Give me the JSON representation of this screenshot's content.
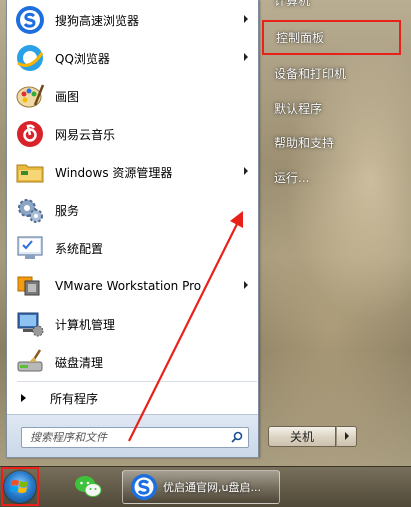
{
  "programs": [
    {
      "label": "搜狗高速浏览器",
      "icon": "sogou-browser-icon",
      "has_submenu": true
    },
    {
      "label": "QQ浏览器",
      "icon": "qq-browser-icon",
      "has_submenu": true
    },
    {
      "label": "画图",
      "icon": "paint-icon",
      "has_submenu": false
    },
    {
      "label": "网易云音乐",
      "icon": "netease-music-icon",
      "has_submenu": false
    },
    {
      "label": "Windows 资源管理器",
      "icon": "explorer-folder-icon",
      "has_submenu": true
    },
    {
      "label": "服务",
      "icon": "services-gear-icon",
      "has_submenu": false
    },
    {
      "label": "系统配置",
      "icon": "system-config-icon",
      "has_submenu": false
    },
    {
      "label": "VMware Workstation Pro",
      "icon": "vmware-icon",
      "has_submenu": true
    },
    {
      "label": "计算机管理",
      "icon": "computer-management-icon",
      "has_submenu": false
    },
    {
      "label": "磁盘清理",
      "icon": "disk-cleanup-icon",
      "has_submenu": false
    }
  ],
  "all_programs_label": "所有程序",
  "search": {
    "placeholder": "搜索程序和文件"
  },
  "right_panel": {
    "top_partial": "计算机",
    "items": [
      "控制面板",
      "设备和打印机",
      "默认程序",
      "帮助和支持",
      "运行..."
    ]
  },
  "shutdown_label": "关机",
  "taskbar": {
    "window_title": "优启通官网,u盘启..."
  },
  "colors": {
    "highlight_red": "#e8211a",
    "annotation_arrow": "#e8211a"
  }
}
